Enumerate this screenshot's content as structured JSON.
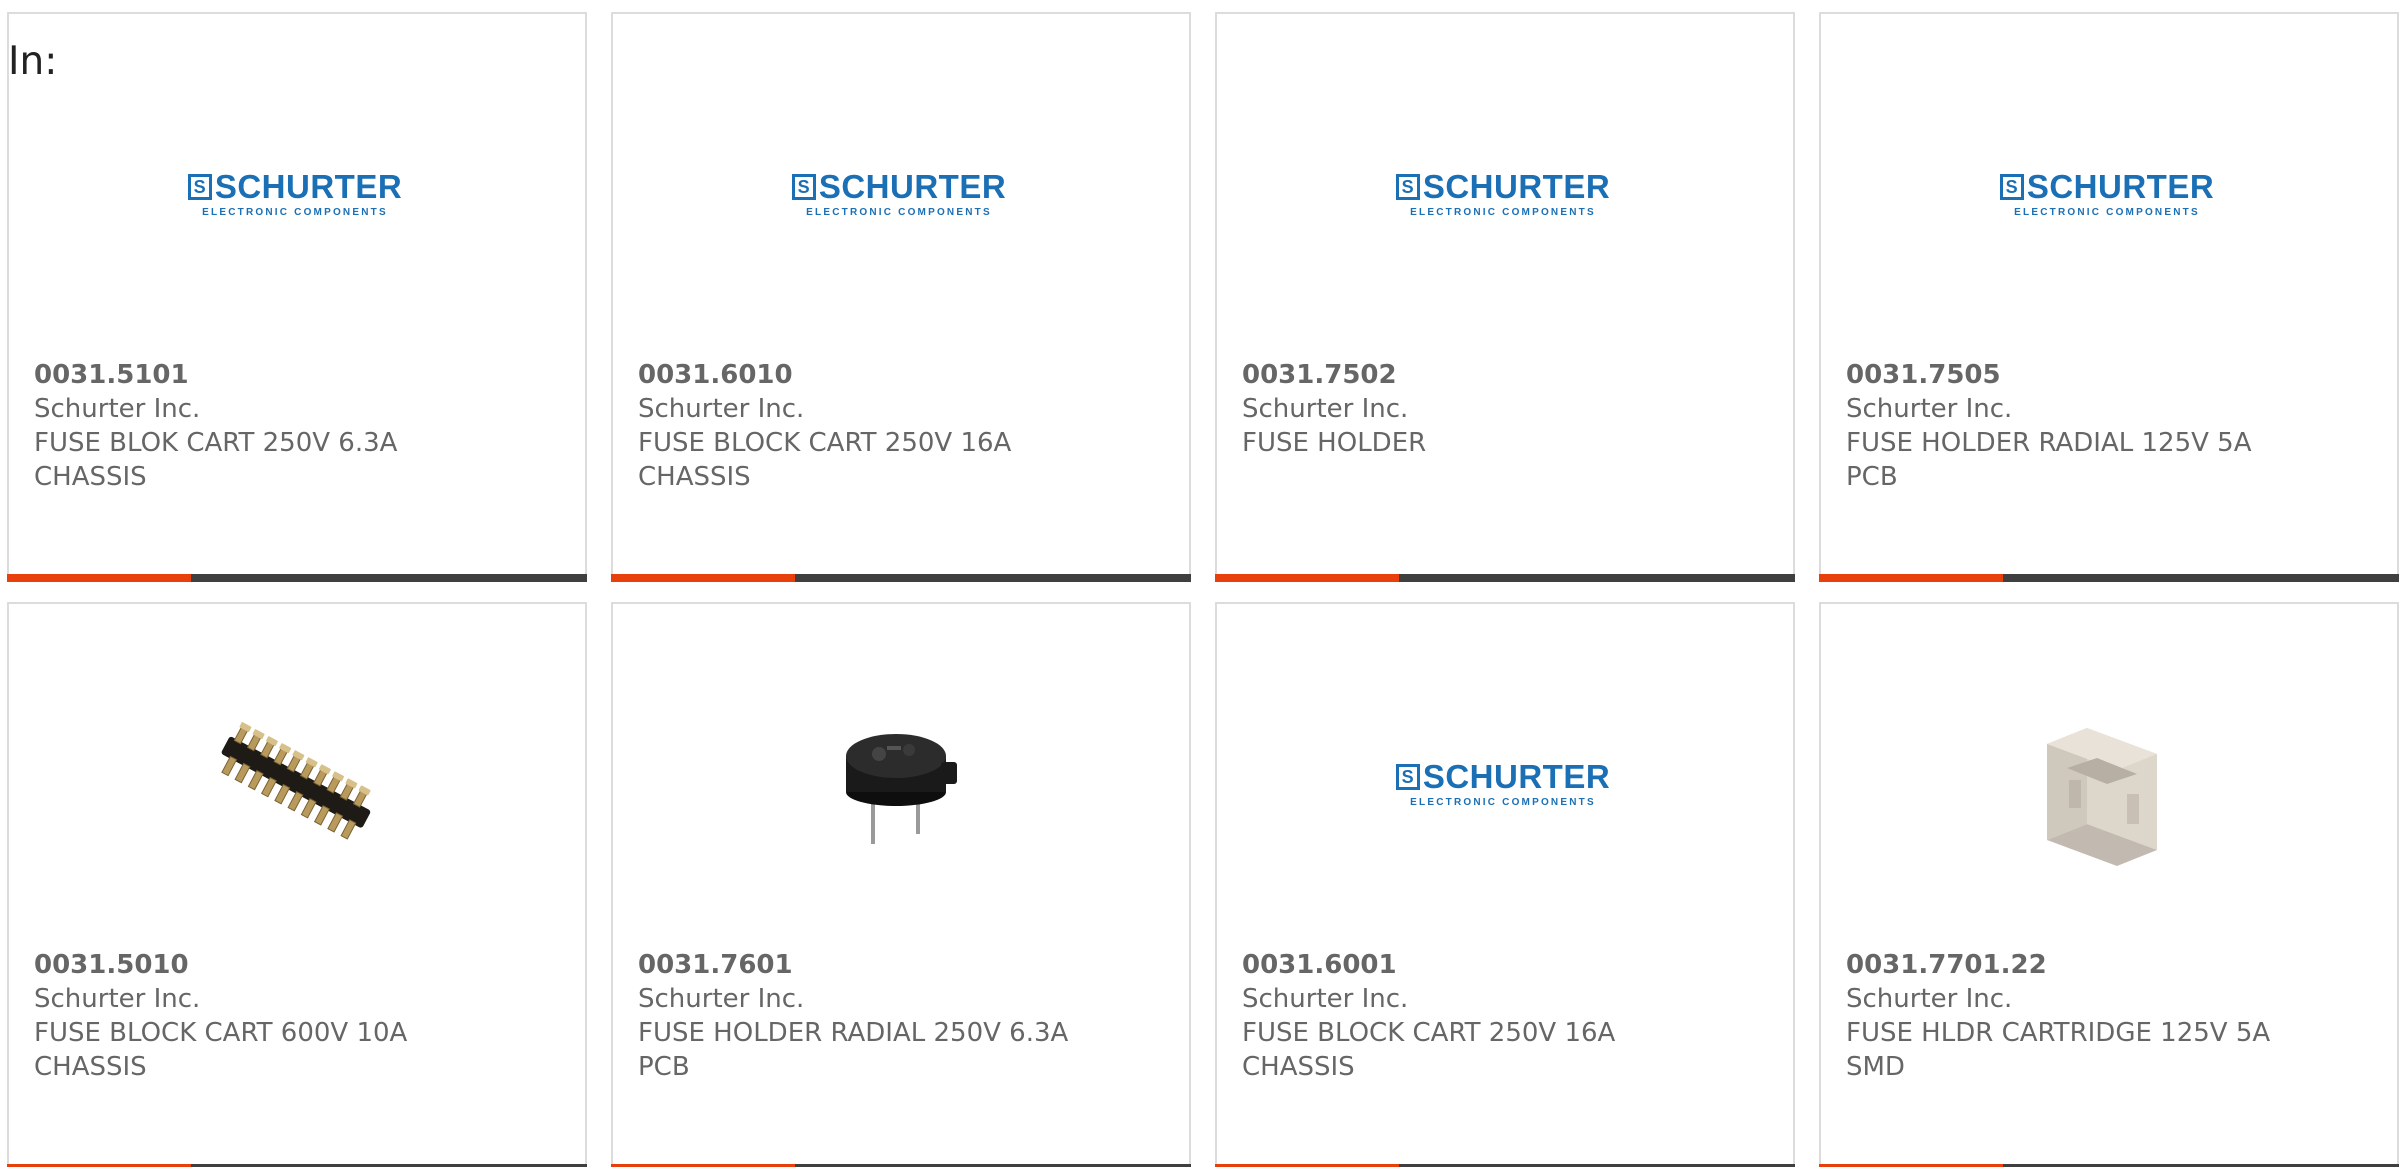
{
  "header": {
    "in_label": "In:"
  },
  "brand": {
    "logo_main": "SCHURTER",
    "logo_mark": "S",
    "logo_sub": "ELECTRONIC COMPONENTS",
    "logo_color": "#1a6fb5"
  },
  "colors": {
    "accent_bar": "#e8400c",
    "dark_bar": "#3f3f3f",
    "card_border": "#dcdcdc",
    "text": "#666666"
  },
  "products": [
    {
      "part_number": "0031.5101",
      "manufacturer": "Schurter Inc.",
      "description_line1": "FUSE BLOK CART 250V 6.3A",
      "description_line2": "CHASSIS",
      "image": "schurter-logo"
    },
    {
      "part_number": "0031.6010",
      "manufacturer": "Schurter Inc.",
      "description_line1": "FUSE BLOCK CART 250V 16A",
      "description_line2": "CHASSIS",
      "image": "schurter-logo"
    },
    {
      "part_number": "0031.7502",
      "manufacturer": "Schurter Inc.",
      "description_line1": "FUSE HOLDER",
      "description_line2": "",
      "image": "schurter-logo"
    },
    {
      "part_number": "0031.7505",
      "manufacturer": "Schurter Inc.",
      "description_line1": "FUSE HOLDER RADIAL 125V 5A",
      "description_line2": "PCB",
      "image": "schurter-logo"
    },
    {
      "part_number": "0031.5010",
      "manufacturer": "Schurter Inc.",
      "description_line1": "FUSE BLOCK CART 600V 10A",
      "description_line2": "CHASSIS",
      "image": "pin-header-photo"
    },
    {
      "part_number": "0031.7601",
      "manufacturer": "Schurter Inc.",
      "description_line1": "FUSE HOLDER RADIAL 250V 6.3A",
      "description_line2": "PCB",
      "image": "radial-fuse-holder-photo"
    },
    {
      "part_number": "0031.6001",
      "manufacturer": "Schurter Inc.",
      "description_line1": "FUSE BLOCK CART 250V 16A",
      "description_line2": "CHASSIS",
      "image": "schurter-logo"
    },
    {
      "part_number": "0031.7701.22",
      "manufacturer": "Schurter Inc.",
      "description_line1": "FUSE HLDR CARTRIDGE 125V 5A",
      "description_line2": "SMD",
      "image": "smd-fuse-clip-photo"
    }
  ]
}
